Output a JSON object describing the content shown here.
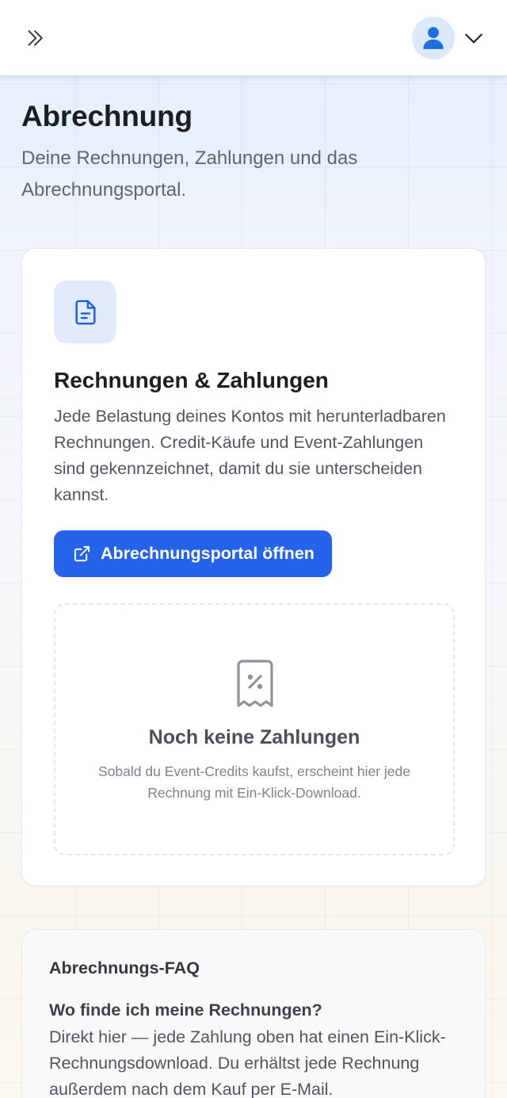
{
  "header": {
    "expand_icon": "chevrons-right-icon",
    "avatar_icon": "user-icon",
    "account_menu_icon": "chevron-down-icon"
  },
  "page": {
    "title": "Abrechnung",
    "subtitle": "Deine Rechnungen, Zahlungen und das Abrechnungsportal."
  },
  "invoices_card": {
    "icon": "file-text-icon",
    "title": "Rechnungen & Zahlungen",
    "description": "Jede Belastung deines Kontos mit herunterladbaren Rechnungen. Credit-Käufe und Event-Zahlungen sind gekennzeichnet, damit du sie unterscheiden kannst.",
    "portal_button_label": "Abrechnungsportal öffnen",
    "portal_button_icon": "external-link-icon",
    "empty_state": {
      "icon": "receipt-percent-icon",
      "title": "Noch keine Zahlungen",
      "description": "Sobald du Event-Credits kaufst, erscheint hier jede Rechnung mit Ein-Klick-Download."
    }
  },
  "faq": {
    "title": "Abrechnungs-FAQ",
    "items": [
      {
        "question": "Wo finde ich meine Rechnungen?",
        "answer": "Direkt hier — jede Zahlung oben hat einen Ein-Klick-Rechnungsdownload. Du erhältst jede Rechnung außerdem nach dem Kauf per E-Mail."
      }
    ]
  },
  "colors": {
    "primary": "#2563eb",
    "icon_tile_bg": "#e1ebfb",
    "avatar_bg": "#dbe9fb",
    "avatar_fg": "#1d6fe0"
  }
}
